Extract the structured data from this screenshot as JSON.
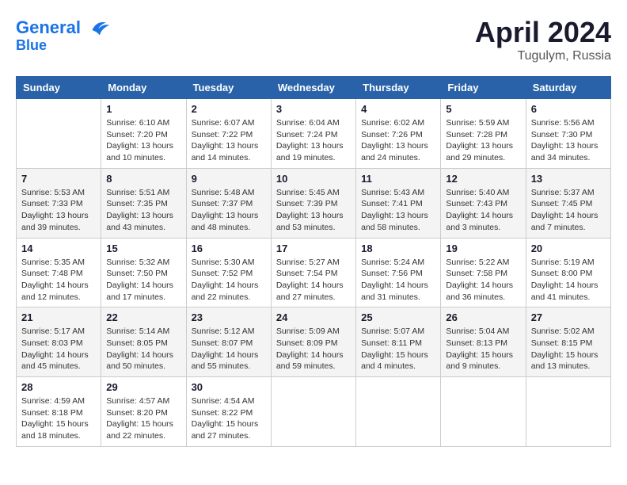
{
  "header": {
    "logo_line1": "General",
    "logo_line2": "Blue",
    "month_title": "April 2024",
    "location": "Tugulym, Russia"
  },
  "weekdays": [
    "Sunday",
    "Monday",
    "Tuesday",
    "Wednesday",
    "Thursday",
    "Friday",
    "Saturday"
  ],
  "weeks": [
    [
      {
        "day": "",
        "info": ""
      },
      {
        "day": "1",
        "info": "Sunrise: 6:10 AM\nSunset: 7:20 PM\nDaylight: 13 hours\nand 10 minutes."
      },
      {
        "day": "2",
        "info": "Sunrise: 6:07 AM\nSunset: 7:22 PM\nDaylight: 13 hours\nand 14 minutes."
      },
      {
        "day": "3",
        "info": "Sunrise: 6:04 AM\nSunset: 7:24 PM\nDaylight: 13 hours\nand 19 minutes."
      },
      {
        "day": "4",
        "info": "Sunrise: 6:02 AM\nSunset: 7:26 PM\nDaylight: 13 hours\nand 24 minutes."
      },
      {
        "day": "5",
        "info": "Sunrise: 5:59 AM\nSunset: 7:28 PM\nDaylight: 13 hours\nand 29 minutes."
      },
      {
        "day": "6",
        "info": "Sunrise: 5:56 AM\nSunset: 7:30 PM\nDaylight: 13 hours\nand 34 minutes."
      }
    ],
    [
      {
        "day": "7",
        "info": "Sunrise: 5:53 AM\nSunset: 7:33 PM\nDaylight: 13 hours\nand 39 minutes."
      },
      {
        "day": "8",
        "info": "Sunrise: 5:51 AM\nSunset: 7:35 PM\nDaylight: 13 hours\nand 43 minutes."
      },
      {
        "day": "9",
        "info": "Sunrise: 5:48 AM\nSunset: 7:37 PM\nDaylight: 13 hours\nand 48 minutes."
      },
      {
        "day": "10",
        "info": "Sunrise: 5:45 AM\nSunset: 7:39 PM\nDaylight: 13 hours\nand 53 minutes."
      },
      {
        "day": "11",
        "info": "Sunrise: 5:43 AM\nSunset: 7:41 PM\nDaylight: 13 hours\nand 58 minutes."
      },
      {
        "day": "12",
        "info": "Sunrise: 5:40 AM\nSunset: 7:43 PM\nDaylight: 14 hours\nand 3 minutes."
      },
      {
        "day": "13",
        "info": "Sunrise: 5:37 AM\nSunset: 7:45 PM\nDaylight: 14 hours\nand 7 minutes."
      }
    ],
    [
      {
        "day": "14",
        "info": "Sunrise: 5:35 AM\nSunset: 7:48 PM\nDaylight: 14 hours\nand 12 minutes."
      },
      {
        "day": "15",
        "info": "Sunrise: 5:32 AM\nSunset: 7:50 PM\nDaylight: 14 hours\nand 17 minutes."
      },
      {
        "day": "16",
        "info": "Sunrise: 5:30 AM\nSunset: 7:52 PM\nDaylight: 14 hours\nand 22 minutes."
      },
      {
        "day": "17",
        "info": "Sunrise: 5:27 AM\nSunset: 7:54 PM\nDaylight: 14 hours\nand 27 minutes."
      },
      {
        "day": "18",
        "info": "Sunrise: 5:24 AM\nSunset: 7:56 PM\nDaylight: 14 hours\nand 31 minutes."
      },
      {
        "day": "19",
        "info": "Sunrise: 5:22 AM\nSunset: 7:58 PM\nDaylight: 14 hours\nand 36 minutes."
      },
      {
        "day": "20",
        "info": "Sunrise: 5:19 AM\nSunset: 8:00 PM\nDaylight: 14 hours\nand 41 minutes."
      }
    ],
    [
      {
        "day": "21",
        "info": "Sunrise: 5:17 AM\nSunset: 8:03 PM\nDaylight: 14 hours\nand 45 minutes."
      },
      {
        "day": "22",
        "info": "Sunrise: 5:14 AM\nSunset: 8:05 PM\nDaylight: 14 hours\nand 50 minutes."
      },
      {
        "day": "23",
        "info": "Sunrise: 5:12 AM\nSunset: 8:07 PM\nDaylight: 14 hours\nand 55 minutes."
      },
      {
        "day": "24",
        "info": "Sunrise: 5:09 AM\nSunset: 8:09 PM\nDaylight: 14 hours\nand 59 minutes."
      },
      {
        "day": "25",
        "info": "Sunrise: 5:07 AM\nSunset: 8:11 PM\nDaylight: 15 hours\nand 4 minutes."
      },
      {
        "day": "26",
        "info": "Sunrise: 5:04 AM\nSunset: 8:13 PM\nDaylight: 15 hours\nand 9 minutes."
      },
      {
        "day": "27",
        "info": "Sunrise: 5:02 AM\nSunset: 8:15 PM\nDaylight: 15 hours\nand 13 minutes."
      }
    ],
    [
      {
        "day": "28",
        "info": "Sunrise: 4:59 AM\nSunset: 8:18 PM\nDaylight: 15 hours\nand 18 minutes."
      },
      {
        "day": "29",
        "info": "Sunrise: 4:57 AM\nSunset: 8:20 PM\nDaylight: 15 hours\nand 22 minutes."
      },
      {
        "day": "30",
        "info": "Sunrise: 4:54 AM\nSunset: 8:22 PM\nDaylight: 15 hours\nand 27 minutes."
      },
      {
        "day": "",
        "info": ""
      },
      {
        "day": "",
        "info": ""
      },
      {
        "day": "",
        "info": ""
      },
      {
        "day": "",
        "info": ""
      }
    ]
  ]
}
